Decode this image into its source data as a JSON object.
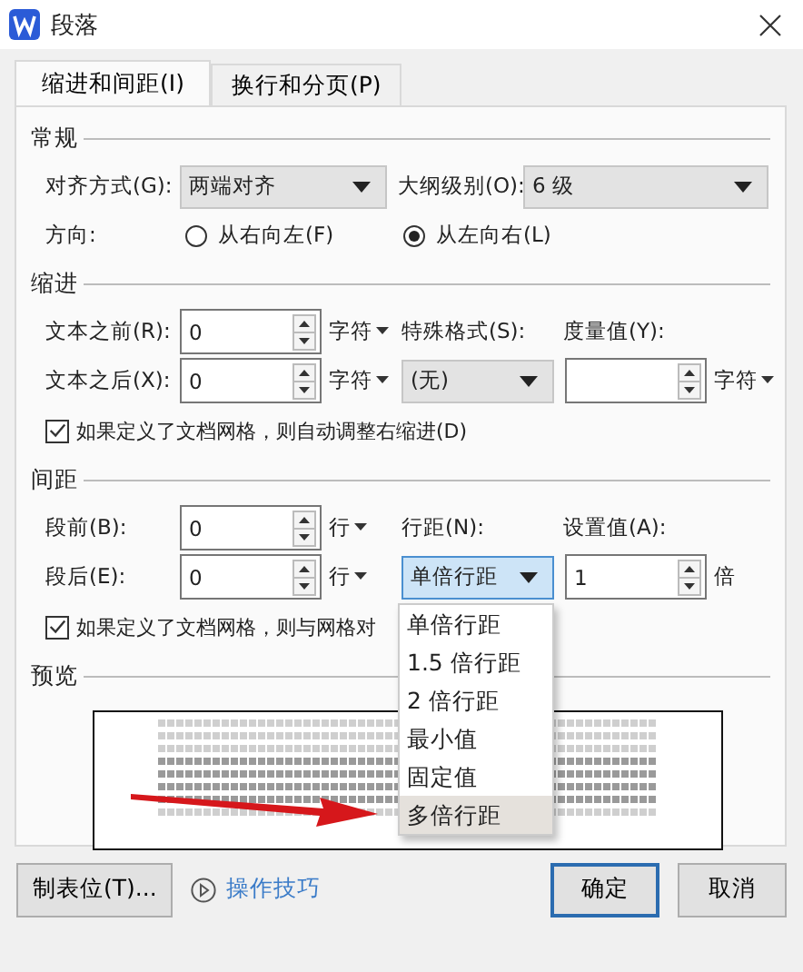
{
  "window": {
    "title": "段落"
  },
  "tabs": [
    {
      "label": "缩进和间距(I)",
      "selected": true
    },
    {
      "label": "换行和分页(P)",
      "selected": false
    }
  ],
  "general": {
    "heading": "常规",
    "alignment": {
      "label": "对齐方式(G):",
      "value": "两端对齐"
    },
    "outline_level": {
      "label": "大纲级别(O):",
      "value": "6 级"
    },
    "direction": {
      "label": "方向:",
      "options": [
        {
          "label": "从右向左(F)",
          "selected": false
        },
        {
          "label": "从左向右(L)",
          "selected": true
        }
      ]
    }
  },
  "indentation": {
    "heading": "缩进",
    "before": {
      "label": "文本之前(R):",
      "value": "0",
      "unit": "字符"
    },
    "after": {
      "label": "文本之后(X):",
      "value": "0",
      "unit": "字符"
    },
    "special": {
      "label": "特殊格式(S):",
      "value": "(无)"
    },
    "measure": {
      "label": "度量值(Y):",
      "unit": "字符"
    },
    "auto_adjust": {
      "label": "如果定义了文档网格，则自动调整右缩进(D)",
      "checked": true
    }
  },
  "spacing": {
    "heading": "间距",
    "before": {
      "label": "段前(B):",
      "value": "0",
      "unit": "行"
    },
    "after": {
      "label": "段后(E):",
      "value": "0",
      "unit": "行"
    },
    "line_spacing": {
      "label": "行距(N):",
      "value": "单倍行距"
    },
    "setting": {
      "label": "设置值(A):",
      "value": "1",
      "unit": "倍"
    },
    "snap_to_grid": {
      "label": "如果定义了文档网格，则与网格对",
      "checked": true
    }
  },
  "dropdown": {
    "items": [
      {
        "label": "单倍行距",
        "selected": false
      },
      {
        "label": "1.5 倍行距",
        "selected": false
      },
      {
        "label": "2 倍行距",
        "selected": false
      },
      {
        "label": "最小值",
        "selected": false
      },
      {
        "label": "固定值",
        "selected": false
      },
      {
        "label": "多倍行距",
        "selected": true
      }
    ]
  },
  "preview": {
    "heading": "预览"
  },
  "annotation": {
    "kind": "arrow"
  },
  "buttons": {
    "tabs": "制表位(T)...",
    "tips": "操作技巧",
    "ok": "确定",
    "cancel": "取消"
  }
}
